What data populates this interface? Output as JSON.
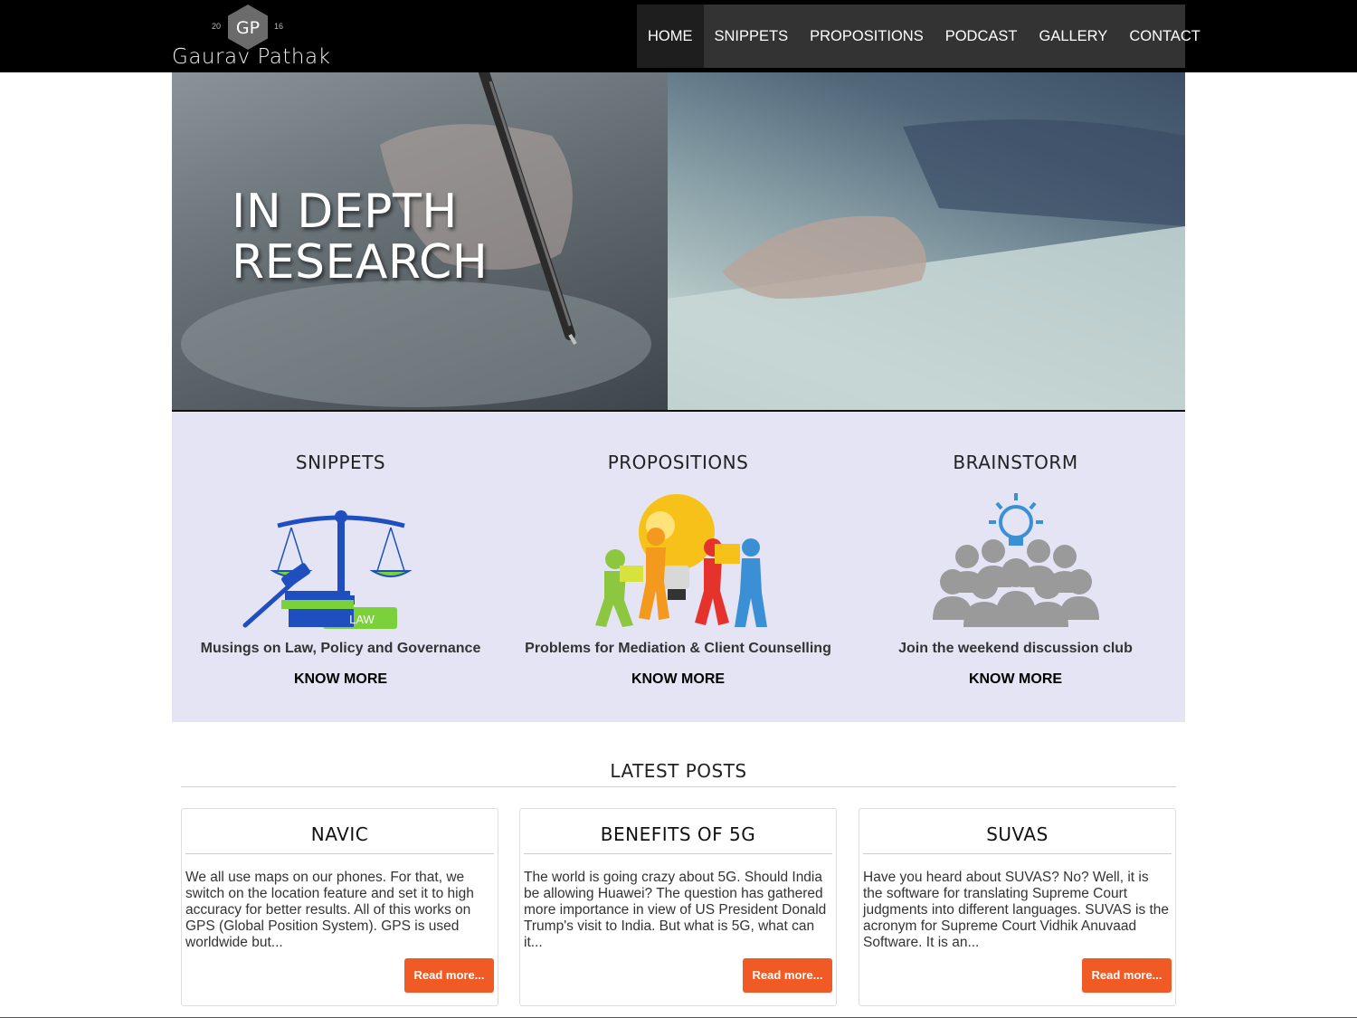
{
  "header": {
    "logo_initials": "GP",
    "logo_year_left": "20",
    "logo_year_right": "16",
    "logo_name": "Gaurav Pathak",
    "nav": [
      {
        "label": "HOME",
        "active": true
      },
      {
        "label": "SNIPPETS",
        "active": false
      },
      {
        "label": "PROPOSITIONS",
        "active": false
      },
      {
        "label": "PODCAST",
        "active": false
      },
      {
        "label": "GALLERY",
        "active": false
      },
      {
        "label": "CONTACT",
        "active": false
      }
    ]
  },
  "hero": {
    "title_line1": "IN DEPTH",
    "title_line2": "RESEARCH"
  },
  "features": [
    {
      "title": "SNIPPETS",
      "icon": "law-scales-icon",
      "icon_text": "LAW",
      "description": "Musings on Law, Policy and Governance",
      "link": "KNOW MORE"
    },
    {
      "title": "PROPOSITIONS",
      "icon": "puzzle-team-icon",
      "description": "Problems for Mediation & Client Counselling",
      "link": "KNOW MORE"
    },
    {
      "title": "BRAINSTORM",
      "icon": "group-lightbulb-icon",
      "description": "Join the weekend discussion club",
      "link": "KNOW MORE"
    }
  ],
  "latest": {
    "title": "LATEST POSTS",
    "posts": [
      {
        "title": "NAVIC",
        "excerpt": "We all use maps on our phones. For that, we switch on the location feature and set it to high accuracy for better results. All of this works on GPS (Global Position System). GPS is used worldwide but...",
        "button": "Read more..."
      },
      {
        "title": "BENEFITS OF 5G",
        "excerpt": "The world is going crazy about 5G. Should India be allowing Huawei? The question has gathered more importance in view of US President Donald Trump's visit to India. But what is 5G, what can it...",
        "button": "Read more..."
      },
      {
        "title": "SUVAS",
        "excerpt": "Have you heard about SUVAS? No? Well, it is the software for translating Supreme Court judgments into different languages. SUVAS is the acronym for Supreme Court Vidhik Anuvaad Software. It is an...",
        "button": "Read more..."
      }
    ]
  },
  "colors": {
    "header_bg": "#000000",
    "nav_bg": "#333333",
    "feature_band_bg": "#e4e4f5",
    "button_orange": "#f05a24"
  }
}
